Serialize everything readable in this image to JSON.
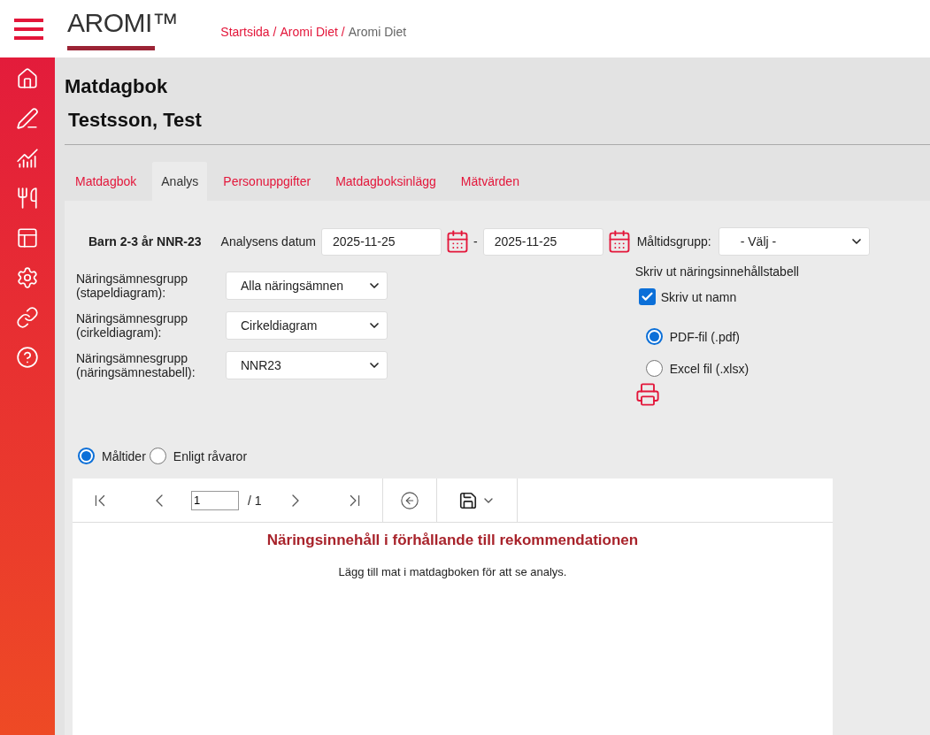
{
  "header": {
    "logo": "AROMI™",
    "breadcrumb": [
      {
        "label": "Startsida",
        "current": false
      },
      {
        "label": "Aromi Diet",
        "current": false
      },
      {
        "label": "Aromi Diet",
        "current": true
      }
    ],
    "separator": "/"
  },
  "page": {
    "title": "Matdagbok",
    "person": "Testsson, Test"
  },
  "tabs": [
    {
      "label": "Matdagbok",
      "selected": false
    },
    {
      "label": "Analys",
      "selected": true
    },
    {
      "label": "Personuppgifter",
      "selected": false
    },
    {
      "label": "Matdagboksinlägg",
      "selected": false
    },
    {
      "label": "Mätvärden",
      "selected": false
    }
  ],
  "form": {
    "profile": "Barn 2-3 år NNR-23",
    "date_label": "Analysens datum",
    "date_from": "2025-11-25",
    "date_separator": "-",
    "date_to": "2025-11-25",
    "meal_group": {
      "label": "Måltidsgrupp:",
      "value": "- Välj -"
    },
    "nutrient_groups": [
      {
        "label": "Näringsämnesgrupp (stapeldiagram):",
        "value": "Alla näringsämnen"
      },
      {
        "label": "Näringsämnesgrupp (cirkeldiagram):",
        "value": "Cirkeldiagram"
      },
      {
        "label": "Näringsämnesgrupp (näringsämnestabell):",
        "value": "NNR23"
      }
    ]
  },
  "print": {
    "title": "Skriv ut näringsinnehållstabell",
    "print_names": {
      "label": "Skriv ut namn",
      "checked": true
    },
    "formats": [
      {
        "label": "PDF-fil (.pdf)",
        "selected": true
      },
      {
        "label": "Excel fil (.xlsx)",
        "selected": false
      }
    ]
  },
  "view_options": [
    {
      "label": "Måltider",
      "selected": true
    },
    {
      "label": "Enligt råvaror",
      "selected": false
    }
  ],
  "report": {
    "page_value": "1",
    "page_total": "/ 1",
    "title": "Näringsinnehåll i förhållande till rekommendationen",
    "message": "Lägg till mat i matdagboken för att se analys."
  }
}
